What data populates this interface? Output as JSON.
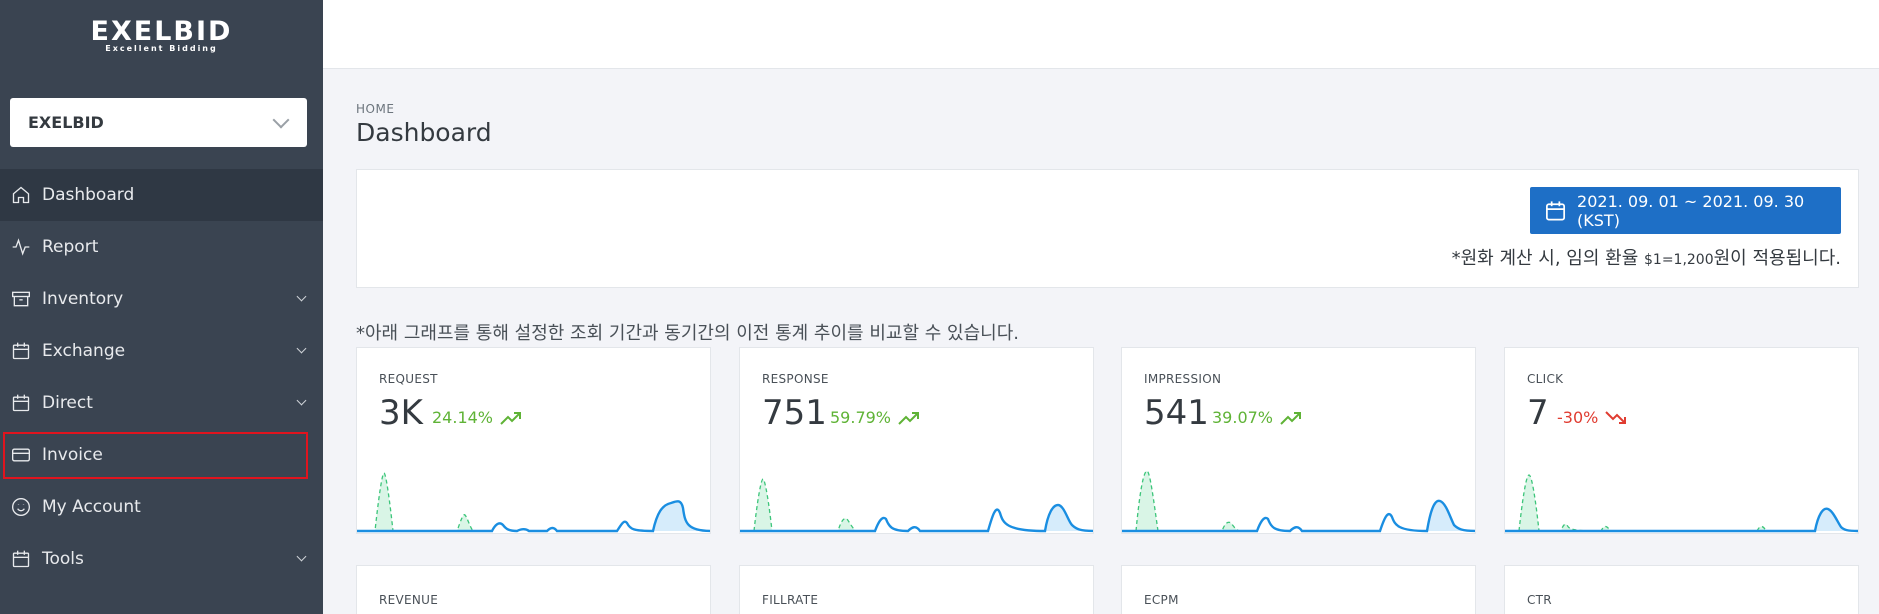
{
  "sidebar": {
    "logo_main": "EXELBID",
    "logo_sub": "Excellent Bidding",
    "account": "EXELBID",
    "items": [
      {
        "label": "Dashboard",
        "icon": "home-icon",
        "active": true,
        "expandable": false
      },
      {
        "label": "Report",
        "icon": "activity-icon",
        "active": false,
        "expandable": false
      },
      {
        "label": "Inventory",
        "icon": "archive-icon",
        "active": false,
        "expandable": true
      },
      {
        "label": "Exchange",
        "icon": "calendar-icon",
        "active": false,
        "expandable": true
      },
      {
        "label": "Direct",
        "icon": "calendar-icon",
        "active": false,
        "expandable": true
      },
      {
        "label": "Invoice",
        "icon": "credit-card-icon",
        "active": false,
        "expandable": false
      },
      {
        "label": "My Account",
        "icon": "smile-icon",
        "active": false,
        "expandable": false
      },
      {
        "label": "Tools",
        "icon": "calendar-icon",
        "active": false,
        "expandable": true
      }
    ]
  },
  "main": {
    "breadcrumb": "HOME",
    "title": "Dashboard",
    "date_range": "2021. 09. 01 ~ 2021. 09. 30 (KST)",
    "rate_note_prefix": "*원화 계산 시, 임의 환율 ",
    "rate_note_rate": "$1=1,200",
    "rate_note_suffix": "원이 적용됩니다.",
    "compare_note": "*아래 그래프를 통해 설정한 조회 기간과 동기간의 이전 통계 추이를 비교할 수 있습니다."
  },
  "cards": [
    {
      "title": "REQUEST",
      "value": "3K",
      "change": "24.14%",
      "direction": "up"
    },
    {
      "title": "RESPONSE",
      "value": "751",
      "change": "59.79%",
      "direction": "up"
    },
    {
      "title": "IMPRESSION",
      "value": "541",
      "change": "39.07%",
      "direction": "up"
    },
    {
      "title": "CLICK",
      "value": "7",
      "change": "-30%",
      "direction": "down"
    }
  ],
  "cards_row2": [
    {
      "title": "REVENUE"
    },
    {
      "title": "FILLRATE"
    },
    {
      "title": "ECPM"
    },
    {
      "title": "CTR"
    }
  ],
  "colors": {
    "sidebar_bg": "#3a4451",
    "accent": "#1e6fc6",
    "up": "#5fb336",
    "down": "#e03c31",
    "highlight": "#e0141e"
  }
}
